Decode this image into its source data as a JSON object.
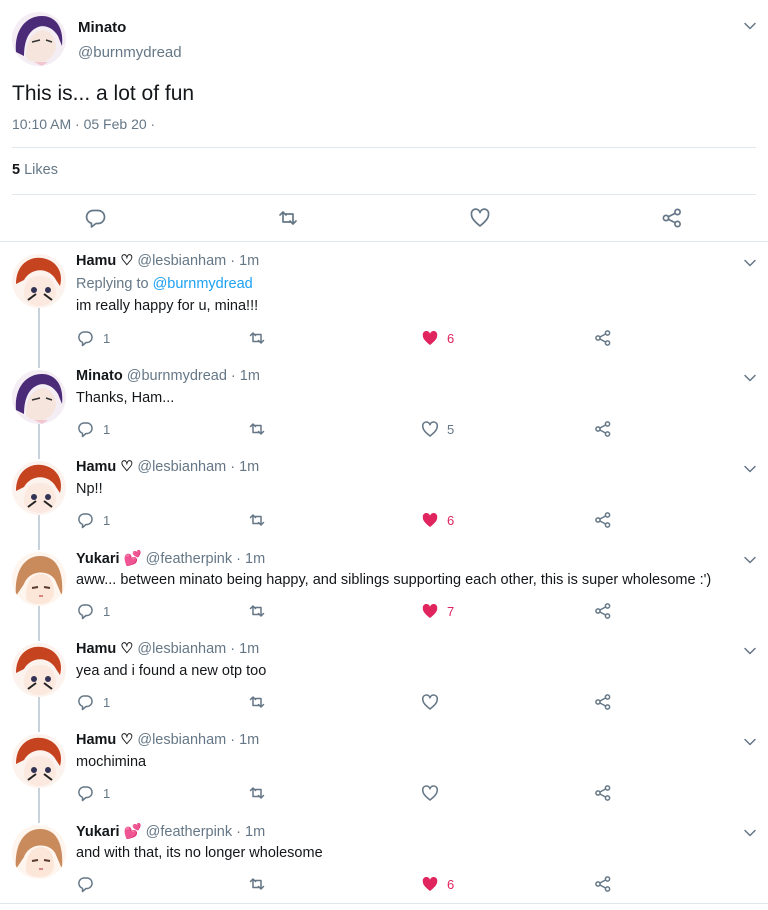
{
  "tweet": {
    "name": "Minato",
    "handle": "@burnmydread",
    "text": "This is... a lot of fun",
    "meta": "10:10 AM · 05 Feb 20 ·",
    "likes_count": "5",
    "likes_label": "Likes"
  },
  "replies": [
    {
      "name": "Hamu ♡",
      "handle": "@lesbianham · 1m",
      "replying_label": "Replying to",
      "replying_to": "@burnmydread",
      "text": "im really happy for u, mina!!!",
      "reply_count": "1",
      "like_count": "6",
      "liked": true
    },
    {
      "name": "Minato",
      "handle": "@burnmydread · 1m",
      "text": "Thanks, Ham...",
      "reply_count": "1",
      "like_count": "5",
      "liked": false
    },
    {
      "name": "Hamu ♡",
      "handle": "@lesbianham · 1m",
      "text": "Np!!",
      "reply_count": "1",
      "like_count": "6",
      "liked": true
    },
    {
      "name": "Yukari 💕",
      "handle": "@featherpink · 1m",
      "text": "aww... between minato being happy, and siblings supporting each other, this is super wholesome :')",
      "reply_count": "1",
      "like_count": "7",
      "liked": true
    },
    {
      "name": "Hamu ♡",
      "handle": "@lesbianham · 1m",
      "text": "yea and i found a new otp too",
      "reply_count": "1",
      "like_count": "",
      "liked": false
    },
    {
      "name": "Hamu ♡",
      "handle": "@lesbianham · 1m",
      "text": "mochimina",
      "reply_count": "1",
      "like_count": "",
      "liked": false
    },
    {
      "name": "Yukari 💕",
      "handle": "@featherpink · 1m",
      "text": "and with that, its no longer wholesome",
      "reply_count": "",
      "like_count": "6",
      "liked": true
    }
  ],
  "colors": {
    "text": "#14171a",
    "secondary": "#657786",
    "link": "#1da1f2",
    "like": "#e0245e",
    "divider": "#e1e8ed"
  },
  "icons": [
    "chevron-down-icon",
    "reply-icon",
    "retweet-icon",
    "like-icon",
    "share-icon"
  ]
}
